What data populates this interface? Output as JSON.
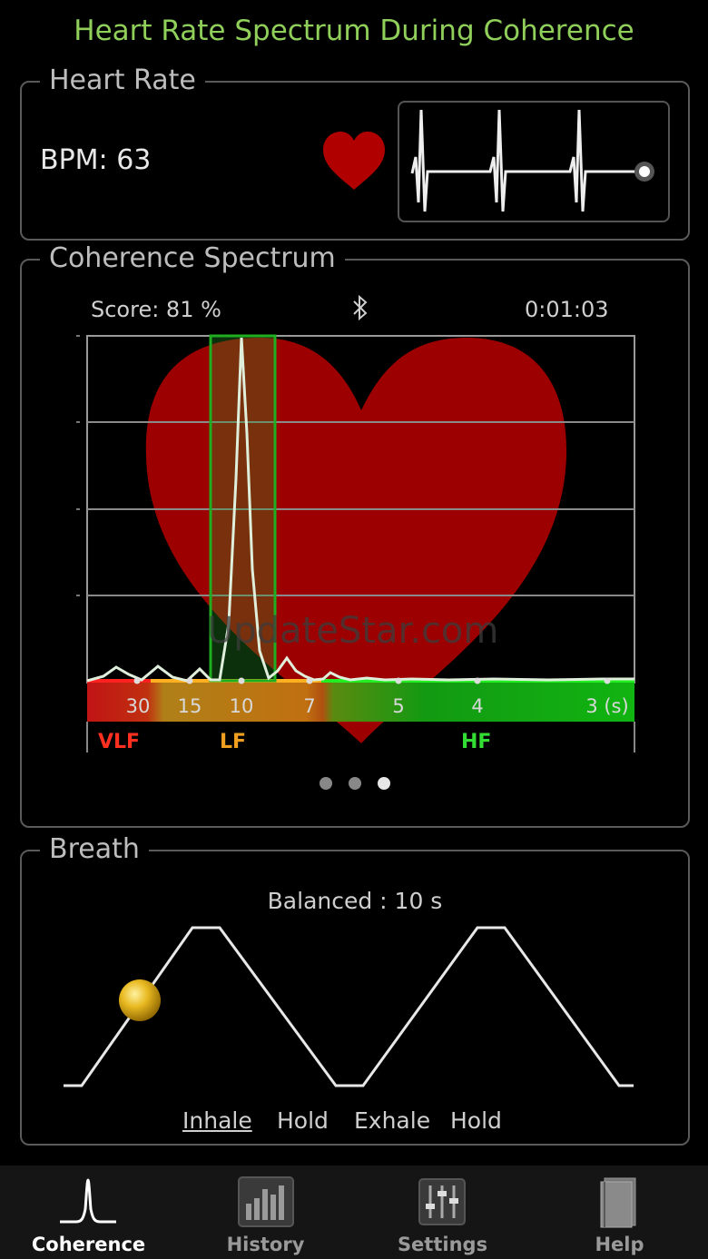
{
  "title": "Heart Rate Spectrum During Coherence",
  "heart_rate": {
    "legend": "Heart Rate",
    "bpm_text": "BPM: 63"
  },
  "spectrum": {
    "legend": "Coherence Spectrum",
    "score_text": "Score: 81 %",
    "time_text": "0:01:03",
    "bluetooth_icon": "bluetooth-icon",
    "tick_labels": [
      "30",
      "15",
      "10",
      "7",
      "5",
      "4",
      "3 (s)"
    ],
    "bands": [
      {
        "name": "VLF",
        "color": "#ff3020"
      },
      {
        "name": "LF",
        "color": "#f0a020"
      },
      {
        "name": "HF",
        "color": "#33dd33"
      }
    ],
    "page_dots": {
      "count": 3,
      "active": 3
    }
  },
  "breath": {
    "legend": "Breath",
    "mode_text": "Balanced : 10 s",
    "phases": [
      "Inhale",
      "Hold",
      "Exhale",
      "Hold"
    ],
    "active_phase": "Inhale"
  },
  "tabs": [
    {
      "label": "Coherence",
      "icon": "coherence-peak-icon",
      "active": true
    },
    {
      "label": "History",
      "icon": "history-bars-icon",
      "active": false
    },
    {
      "label": "Settings",
      "icon": "settings-sliders-icon",
      "active": false
    },
    {
      "label": "Help",
      "icon": "help-book-icon",
      "active": false
    }
  ],
  "watermark": "UpdateStar.com"
}
